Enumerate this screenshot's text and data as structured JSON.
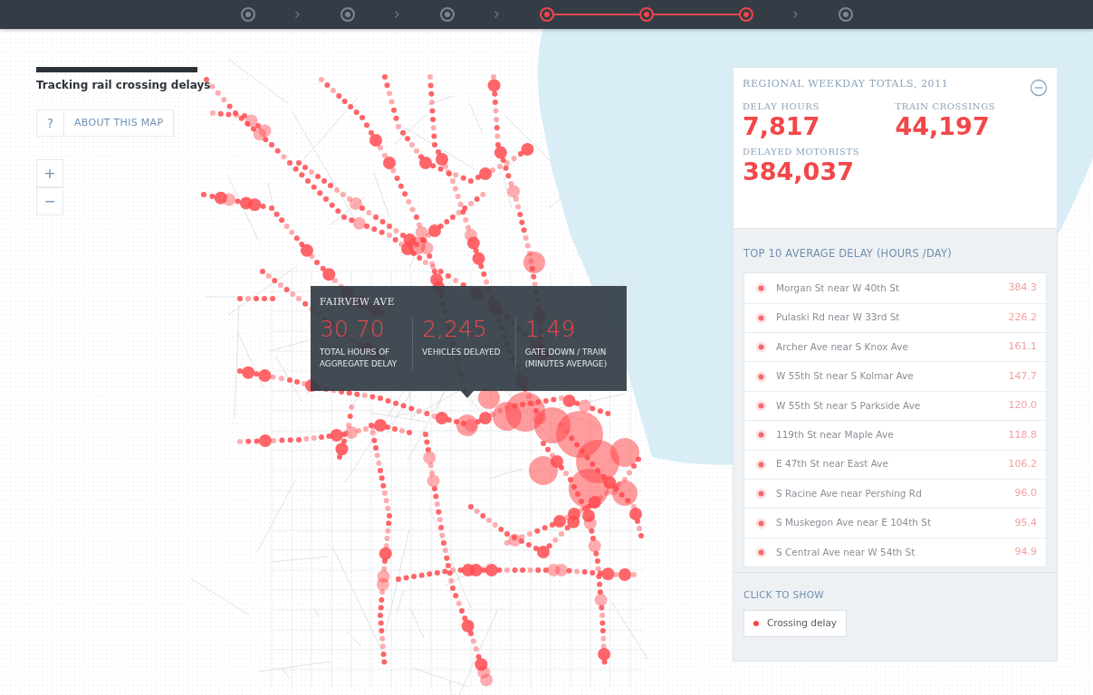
{
  "steps": [
    {
      "selected": false
    },
    {
      "selected": false
    },
    {
      "selected": false
    },
    {
      "selected": true
    },
    {
      "selected": true
    },
    {
      "selected": true
    },
    {
      "selected": false
    }
  ],
  "title": "Tracking rail crossing delays",
  "about_button": {
    "icon": "?",
    "label": "ABOUT THIS MAP"
  },
  "zoom_controls": [
    "+",
    "−"
  ],
  "tooltip": {
    "title": "FAIRVEW AVE",
    "stats": [
      {
        "value": "30.70",
        "label": "TOTAL HOURS OF AGGREGATE DELAY"
      },
      {
        "value": "2,245",
        "label": "VEHICLES DELAYED"
      },
      {
        "value": "1.49",
        "label": "GATE DOWN / TRAIN (MINUTES AVERAGE)"
      }
    ]
  },
  "totals": {
    "title": "REGIONAL WEEKDAY TOTALS, 2011",
    "expanded": true,
    "stats": [
      {
        "label": "DELAY HOURS",
        "value": "7,817"
      },
      {
        "label": "TRAIN CROSSINGS",
        "value": "44,197"
      },
      {
        "label": "DELAYED MOTORISTS",
        "value": "384,037"
      }
    ]
  },
  "top10": {
    "title": "TOP 10 AVERAGE DELAY (HOURS /DAY)",
    "rows": [
      {
        "name": "Morgan St near W 40th St",
        "value": "384.3"
      },
      {
        "name": "Pulaski Rd near W 33rd St",
        "value": "226.2"
      },
      {
        "name": "Archer Ave near S Knox Ave",
        "value": "161.1"
      },
      {
        "name": "W 55th St near S Kolmar Ave",
        "value": "147.7"
      },
      {
        "name": "W 55th St near S Parkside Ave",
        "value": "120.0"
      },
      {
        "name": "119th St near Maple Ave",
        "value": "118.8"
      },
      {
        "name": "E 47th St near East Ave",
        "value": "106.2"
      },
      {
        "name": "S Racine Ave near Pershing Rd",
        "value": "96.0"
      },
      {
        "name": "S Muskegon Ave near E 104th St",
        "value": "95.4"
      },
      {
        "name": "S Central Ave near W 54th St",
        "value": "94.9"
      }
    ]
  },
  "legend": {
    "title": "CLICK TO SHOW",
    "items": [
      {
        "label": "Crossing delay",
        "checked": true
      }
    ]
  }
}
